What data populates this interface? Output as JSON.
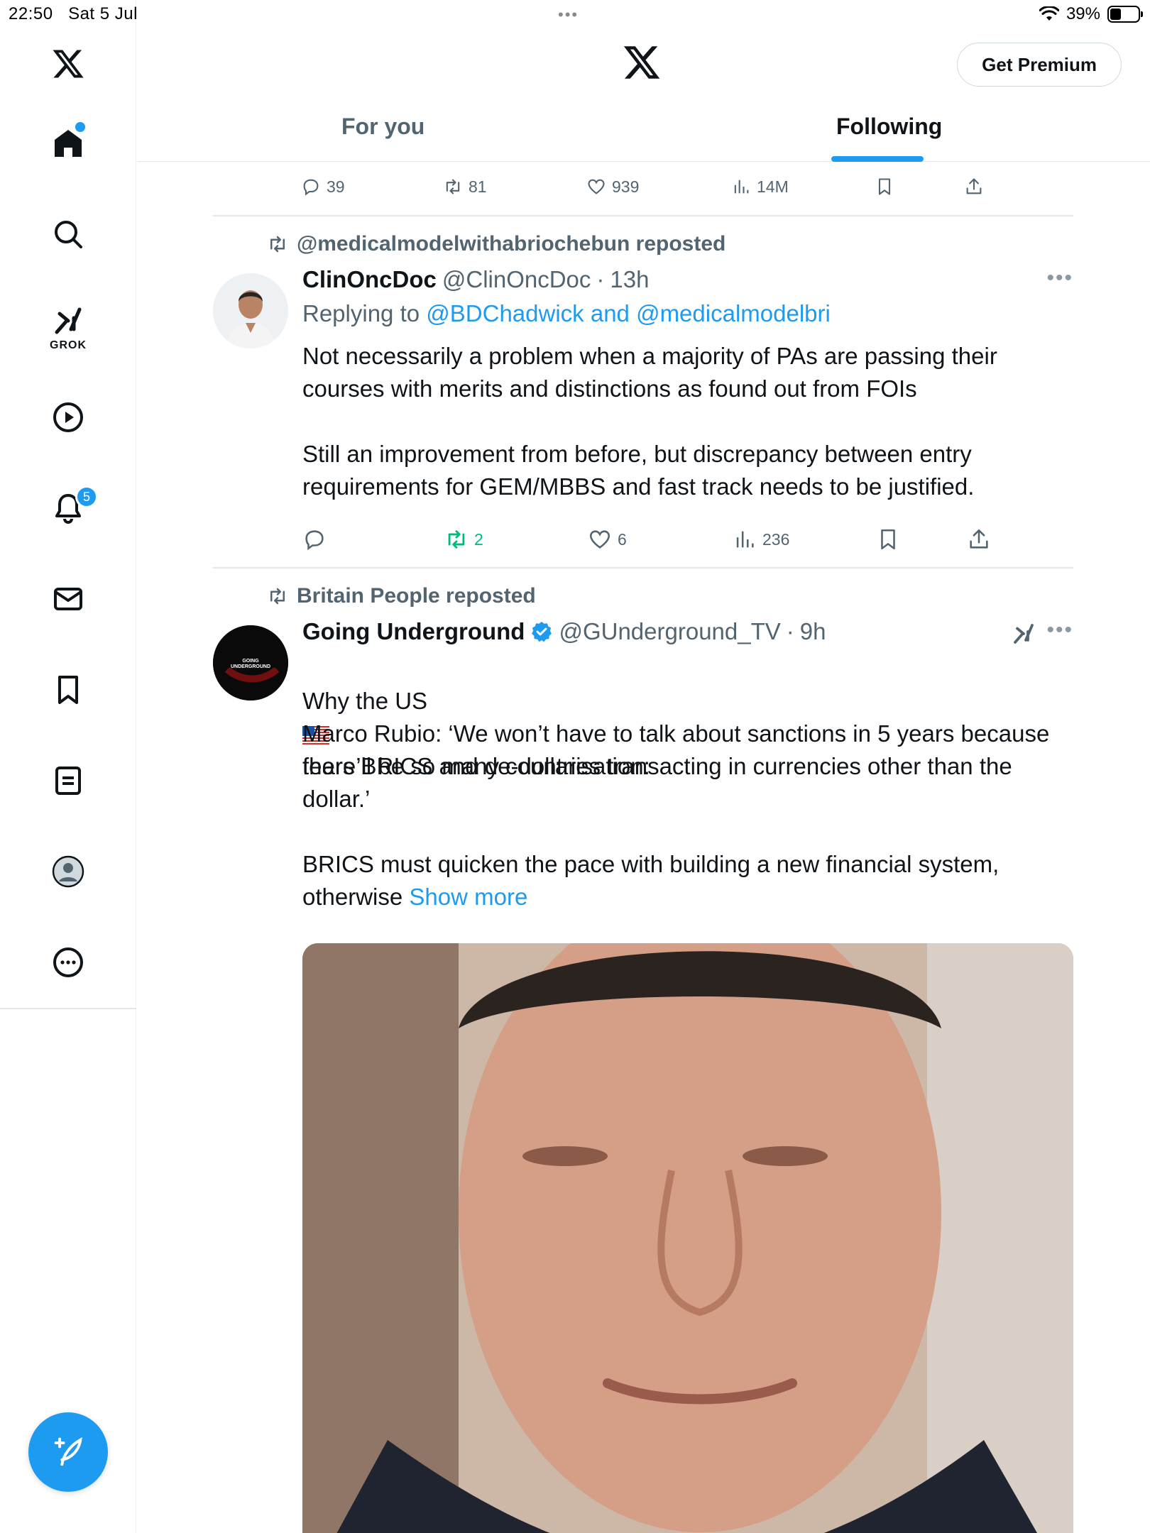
{
  "status_bar": {
    "time": "22:50",
    "date": "Sat 5 Jul",
    "dots": "•••",
    "battery": "39%",
    "battery_level": 0.39
  },
  "nav": {
    "grok_label": "GROK",
    "notifications_count": "5",
    "icons": [
      "x-logo-icon",
      "home-icon",
      "search-icon",
      "grok-icon",
      "video-icon",
      "notifications-icon",
      "messages-icon",
      "bookmarks-icon",
      "lists-icon",
      "profile-icon",
      "more-icon",
      "compose-icon"
    ]
  },
  "header": {
    "premium_label": "Get Premium",
    "tabs": [
      {
        "label": "For you",
        "active": false
      },
      {
        "label": "Following",
        "active": true
      }
    ]
  },
  "prev_tweet_actions": {
    "replies": "39",
    "reposts": "81",
    "likes": "939",
    "views": "14M"
  },
  "tweets": [
    {
      "repost_by": "@medicalmodelwithabriochebun reposted",
      "name": "ClinOncDoc",
      "handle": "@ClinOncDoc",
      "sep": "·",
      "time": "13h",
      "replying_prefix": "Replying to",
      "replying_to": "@BDChadwick and @medicalmodelbri",
      "text": "Not necessarily a problem when a majority of PAs are passing their courses with merits and distinctions as found out from FOIs\n\nStill an improvement from before, but discrepancy between entry requirements for GEM/MBBS and fast track needs to be justified.",
      "actions": {
        "replies": "",
        "reposts": "2",
        "likes": "6",
        "views": "236"
      }
    },
    {
      "repost_by": "Britain People reposted",
      "name": "Going Underground",
      "handle": "@GUnderground_TV",
      "sep": "·",
      "time": "9h",
      "text_line1_a": "Why the US",
      "text_line1_b": "fears BRICS and de-dollarisation:",
      "text_rest": "Marco Rubio: ‘We won’t have to talk about sanctions in 5 years because there’ll be so many countries transacting in currencies other than the dollar.’\n\nBRICS must quicken the pace with building a new financial system, otherwise",
      "show_more": "Show more",
      "avatar_text": "GOING UNDERGROUND"
    }
  ],
  "colors": {
    "accent": "#1d9bf0",
    "repost_green": "#00ba7c",
    "muted": "#536471"
  }
}
